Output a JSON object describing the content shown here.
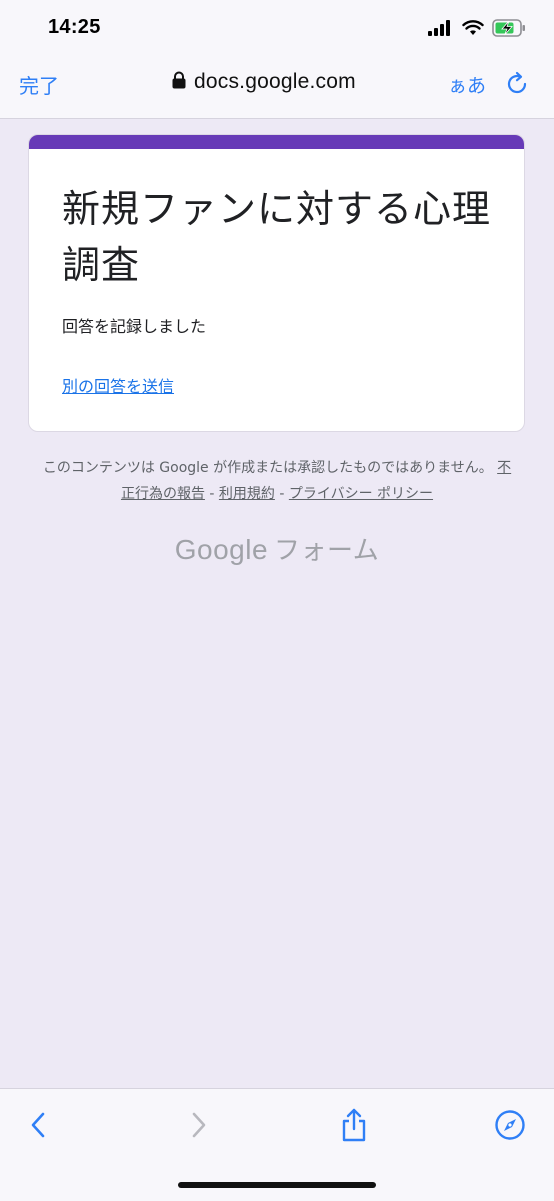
{
  "status_bar": {
    "time": "14:25"
  },
  "browser": {
    "done_label": "完了",
    "url": "docs.google.com",
    "text_size_label": "ぁあ"
  },
  "form": {
    "title": "新規ファンに対する心理調査",
    "confirmation": "回答を記録しました",
    "another_response_link": "別の回答を送信"
  },
  "footer": {
    "disclaimer_prefix": "このコンテンツは Google が作成または承認したものではありません。",
    "report_abuse": "不正行為の報告",
    "separator": " - ",
    "terms": "利用規約",
    "privacy": "プライバシー ポリシー",
    "logo_google": "Google",
    "logo_forms": "フォーム"
  },
  "colors": {
    "accent_purple": "#673ab7",
    "ios_blue": "#2f7ff6",
    "link_blue": "#1a73e8",
    "page_bg": "#ede9f5"
  },
  "icons": [
    "lock-icon",
    "reload-icon",
    "back-icon",
    "forward-icon",
    "share-icon",
    "safari-compass-icon",
    "signal-icon",
    "wifi-icon",
    "battery-charging-icon"
  ]
}
